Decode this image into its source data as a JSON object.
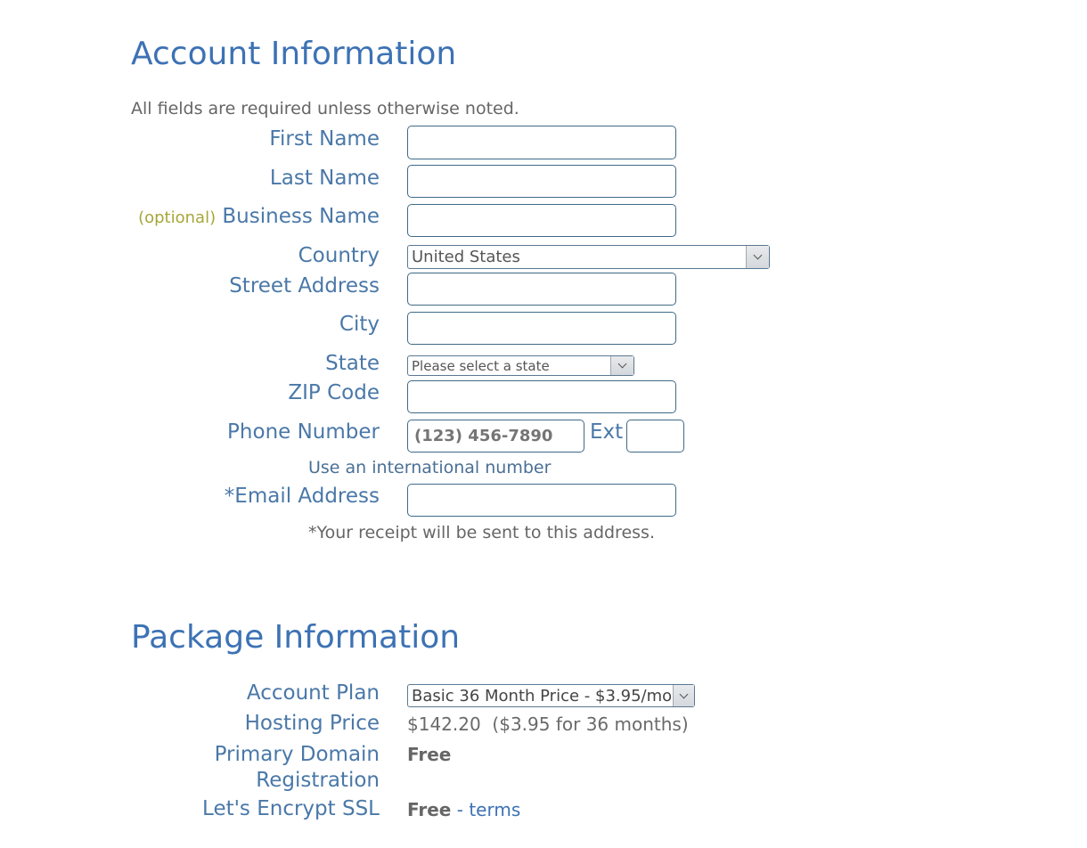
{
  "account": {
    "title": "Account Information",
    "note": "All fields are required unless otherwise noted.",
    "fields": {
      "first_name": {
        "label": "First Name",
        "value": ""
      },
      "last_name": {
        "label": "Last Name",
        "value": ""
      },
      "business_name": {
        "optional_tag": "(optional)",
        "label": "Business Name",
        "value": ""
      },
      "country": {
        "label": "Country",
        "selected": "United States"
      },
      "street_address": {
        "label": "Street Address",
        "value": ""
      },
      "city": {
        "label": "City",
        "value": ""
      },
      "state": {
        "label": "State",
        "selected": "Please select a state"
      },
      "zip": {
        "label": "ZIP Code",
        "value": ""
      },
      "phone": {
        "label": "Phone Number",
        "placeholder": "(123) 456-7890",
        "ext_label": "Ext",
        "ext_value": "",
        "international_link": "Use an international number"
      },
      "email": {
        "label": "*Email Address",
        "value": "",
        "helper": "*Your receipt will be sent to this address."
      }
    }
  },
  "package": {
    "title": "Package Information",
    "account_plan": {
      "label": "Account Plan",
      "selected": "Basic 36 Month Price - $3.95/mo."
    },
    "hosting_price": {
      "label": "Hosting Price",
      "value": "$142.20  ($3.95 for 36 months)"
    },
    "primary_domain": {
      "label_line1": "Primary Domain",
      "label_line2": "Registration",
      "value": "Free"
    },
    "ssl": {
      "label": "Let's Encrypt SSL",
      "value": "Free",
      "separator": " - ",
      "terms_link": "terms"
    }
  }
}
